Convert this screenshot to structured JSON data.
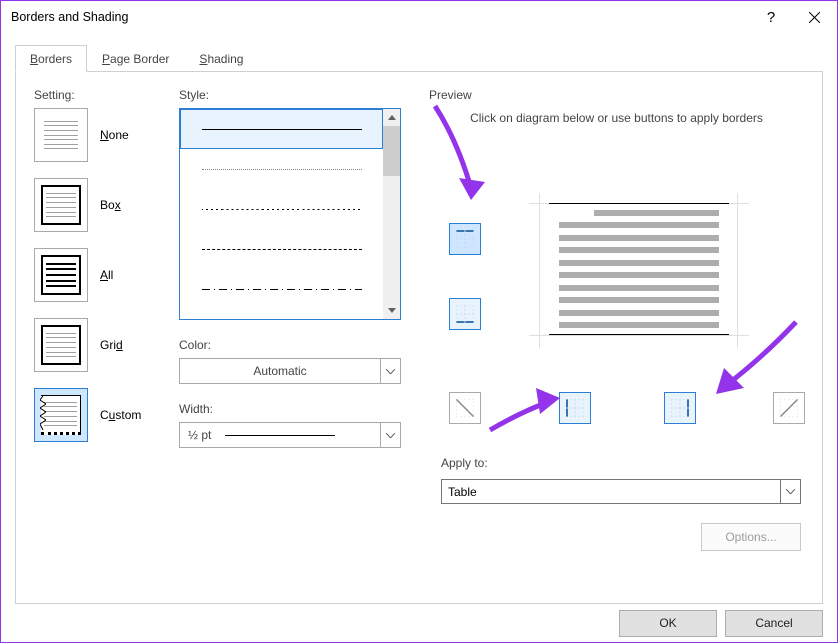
{
  "title": "Borders and Shading",
  "tabs": {
    "borders": {
      "letter": "B",
      "rest": "orders"
    },
    "page_border": {
      "letter": "P",
      "rest": "age Border"
    },
    "shading": {
      "letter": "S",
      "rest": "hading"
    }
  },
  "setting": {
    "label": "Setting:",
    "none": {
      "letter": "N",
      "rest": "one"
    },
    "box": {
      "text": "Bo",
      "letter": "x",
      "rest": ""
    },
    "all": {
      "letter": "A",
      "rest": "ll"
    },
    "grid": {
      "text": "Gri",
      "letter": "d",
      "rest": ""
    },
    "custom": {
      "text": "C",
      "letter": "u",
      "rest": "stom"
    }
  },
  "style": {
    "label": "Style:",
    "letter": "y"
  },
  "color": {
    "label": "Color:",
    "letter": "C",
    "value": "Automatic"
  },
  "width": {
    "label": "Width:",
    "letter": "W",
    "value": "½ pt"
  },
  "preview": {
    "label": "Preview",
    "instruction": "Click on diagram below or use buttons to apply borders"
  },
  "apply_to": {
    "label": "Apply to:",
    "value": "Table"
  },
  "options": "Options...",
  "buttons": {
    "ok": "OK",
    "cancel": "Cancel"
  }
}
